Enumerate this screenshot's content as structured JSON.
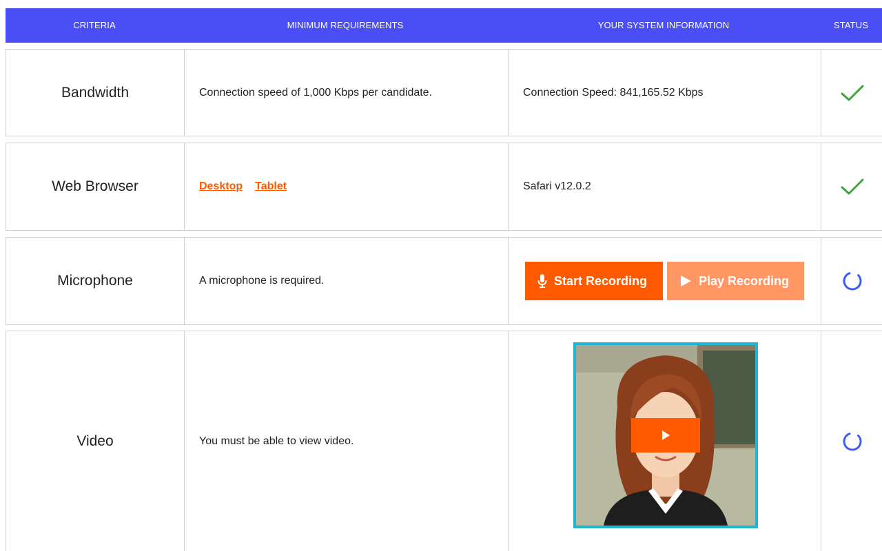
{
  "header": {
    "criteria": "CRITERIA",
    "minimum_requirements": "MINIMUM REQUIREMENTS",
    "system_information": "YOUR SYSTEM INFORMATION",
    "status": "STATUS"
  },
  "rows": {
    "bandwidth": {
      "criteria": "Bandwidth",
      "requirement": "Connection speed of 1,000 Kbps per candidate.",
      "info": "Connection Speed: 841,165.52 Kbps",
      "status": "passed"
    },
    "browser": {
      "criteria": "Web Browser",
      "links": [
        "Desktop",
        "Tablet"
      ],
      "info": "Safari v12.0.2",
      "status": "passed"
    },
    "microphone": {
      "criteria": "Microphone",
      "requirement": "A microphone is required.",
      "start_label": "Start Recording",
      "play_label": "Play Recording",
      "status": "pending"
    },
    "video": {
      "criteria": "Video",
      "requirement": "You must be able to view video.",
      "status": "pending"
    }
  },
  "icons": {
    "passed": "checkmark-icon",
    "pending": "loading-ring-icon",
    "microphone": "microphone-icon",
    "play": "play-icon"
  },
  "colors": {
    "header_bg": "#4a4ef5",
    "accent": "#ff5a00",
    "accent_light": "#ff9664",
    "success": "#3fa33f",
    "pending": "#3d5cf5",
    "video_border": "#1fb6d6"
  }
}
